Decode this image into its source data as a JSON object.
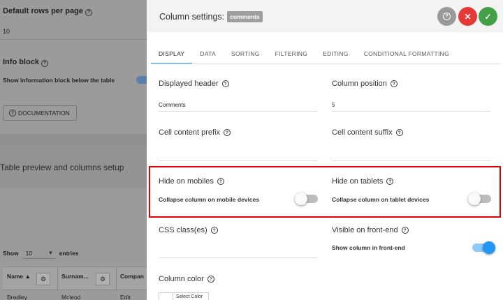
{
  "background": {
    "default_rows_label": "Default rows per page",
    "default_rows_value": "10",
    "info_block_label": "Info block",
    "info_block_sub": "Show information block below the table",
    "documentation_btn": "DOCUMENTATION",
    "preview_title": "Table preview and columns setup",
    "show_label": "Show",
    "show_value": "10",
    "entries_label": "entries",
    "columns": [
      "Name",
      "Surnam...",
      "Compan"
    ],
    "first_row": [
      "Bradley",
      "Mcleod",
      "Edit"
    ]
  },
  "panel": {
    "title": "Column settings:",
    "column_chip": "comments",
    "tabs": [
      {
        "label": "DISPLAY",
        "active": true
      },
      {
        "label": "DATA"
      },
      {
        "label": "SORTING"
      },
      {
        "label": "FILTERING"
      },
      {
        "label": "EDITING"
      },
      {
        "label": "CONDITIONAL FORMATTING"
      }
    ],
    "displayed_header": {
      "label": "Displayed header",
      "value": "Comments"
    },
    "column_position": {
      "label": "Column position",
      "value": "5"
    },
    "cell_prefix": {
      "label": "Cell content prefix",
      "value": ""
    },
    "cell_suffix": {
      "label": "Cell content suffix",
      "value": ""
    },
    "hide_mobiles": {
      "label": "Hide on mobiles",
      "sub": "Collapse column on mobile devices",
      "on": false
    },
    "hide_tablets": {
      "label": "Hide on tablets",
      "sub": "Collapse column on tablet devices",
      "on": false
    },
    "css_classes": {
      "label": "CSS class(es)",
      "value": ""
    },
    "visible_frontend": {
      "label": "Visible on front-end",
      "sub": "Show column in front-end",
      "on": true
    },
    "column_color": {
      "label": "Column color",
      "button": "Select Color"
    }
  },
  "colors": {
    "accent": "#2196f3",
    "close": "#e53935",
    "ok": "#43a047",
    "highlight": "#e00000"
  }
}
